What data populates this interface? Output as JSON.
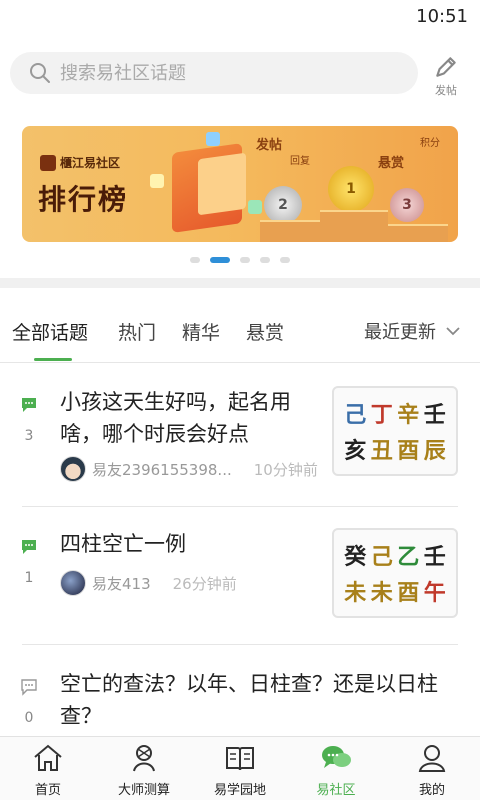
{
  "status": {
    "time": "10:51"
  },
  "search": {
    "placeholder": "搜索易社区话题",
    "post_label": "发帖"
  },
  "banner": {
    "brand": "櫃江易社区",
    "title": "排行榜",
    "labels": [
      "发帖",
      "回复",
      "悬赏",
      "积分"
    ],
    "ranks": [
      "1",
      "2",
      "3"
    ]
  },
  "carousel": {
    "count": 5,
    "active_index": 1
  },
  "tabs": {
    "items": [
      "全部话题",
      "热门",
      "精华",
      "悬赏"
    ],
    "active": "全部话题",
    "sort_label": "最近更新"
  },
  "posts": [
    {
      "title": "小孩这天生好吗，起名用啥，哪个时辰会好点",
      "count": "3",
      "user": "易友2396155398...",
      "time": "10分钟前",
      "pillars": [
        "己",
        "丁",
        "辛",
        "壬",
        "亥",
        "丑",
        "酉",
        "辰"
      ],
      "pillar_colors": [
        "#3a6ea8",
        "#c0392b",
        "#a8801a",
        "#222",
        "#222",
        "#a8801a",
        "#a8801a",
        "#a8801a"
      ]
    },
    {
      "title": "四柱空亡一例",
      "count": "1",
      "user": "易友413",
      "time": "26分钟前",
      "pillars": [
        "癸",
        "己",
        "乙",
        "壬",
        "未",
        "未",
        "酉",
        "午"
      ],
      "pillar_colors": [
        "#222",
        "#a8801a",
        "#2e8b3a",
        "#222",
        "#a8801a",
        "#a8801a",
        "#a8801a",
        "#c0392b"
      ]
    },
    {
      "title": "空亡的查法？以年、日柱查？还是以日柱查？",
      "count": "0"
    }
  ],
  "bottom_nav": {
    "items": [
      "首页",
      "大师测算",
      "易学园地",
      "易社区",
      "我的"
    ],
    "active": "易社区"
  },
  "colors": {
    "accent": "#4caf50",
    "carousel_active": "#2f8fd8"
  }
}
